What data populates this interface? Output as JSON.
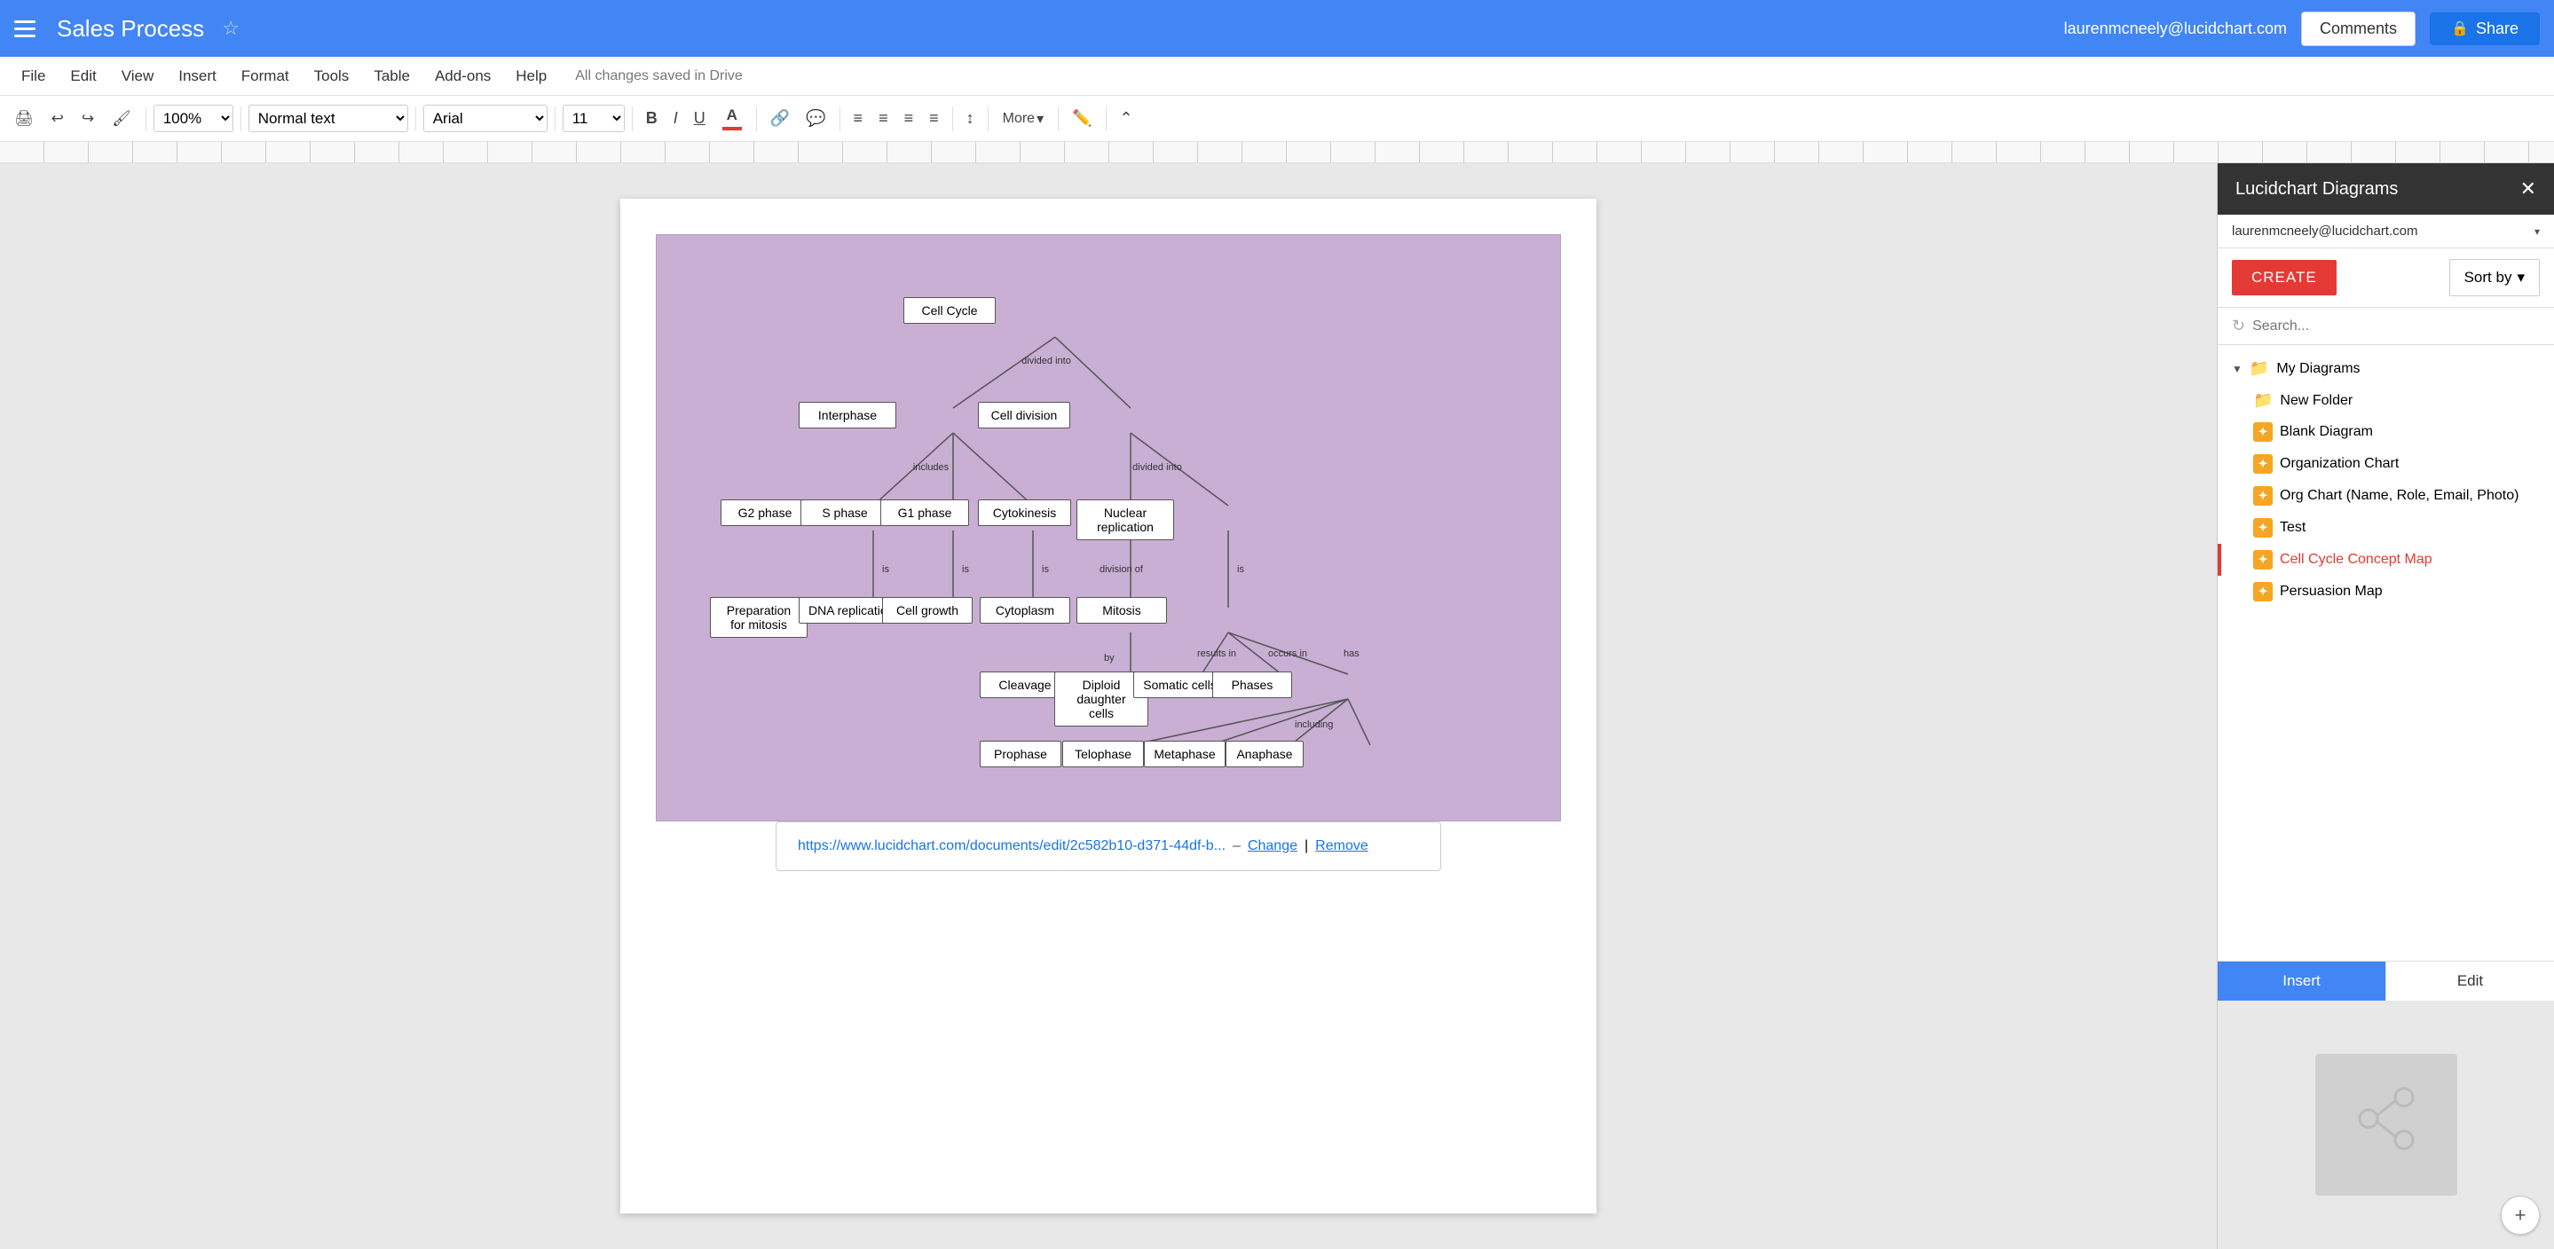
{
  "topbar": {
    "doc_title": "Sales Process",
    "user_email": "laurenmcneely@lucidchart.com",
    "comments_label": "Comments",
    "share_label": "Share",
    "lock_icon": "🔒"
  },
  "menubar": {
    "items": [
      "File",
      "Edit",
      "View",
      "Insert",
      "Format",
      "Tools",
      "Table",
      "Add-ons",
      "Help"
    ],
    "save_status": "All changes saved in Drive"
  },
  "toolbar": {
    "zoom": "100%",
    "style": "Normal text",
    "font": "Arial",
    "size": "11",
    "bold": "B",
    "italic": "I",
    "underline": "U",
    "more_label": "More"
  },
  "diagram": {
    "nodes": {
      "cell_cycle": "Cell Cycle",
      "interphase": "Interphase",
      "cell_division": "Cell division",
      "g2_phase": "G2 phase",
      "s_phase": "S phase",
      "g1_phase": "G1 phase",
      "cytokinesis": "Cytokinesis",
      "nuclear_replication": "Nuclear replication",
      "prep_mitosis": "Preparation for mitosis",
      "dna_replication": "DNA replication",
      "cell_growth": "Cell growth",
      "cytoplasm": "Cytoplasm",
      "mitosis": "Mitosis",
      "cleavage": "Cleavage",
      "diploid_daughter": "Diploid daughter cells",
      "somatic_cells": "Somatic cells",
      "phases": "Phases",
      "prophase": "Prophase",
      "telophase": "Telophase",
      "metaphase": "Metaphase",
      "anaphase": "Anaphase"
    },
    "edge_labels": {
      "divided_into": "divided into",
      "includes": "includes",
      "divided_into2": "divided into",
      "is": "is",
      "division_of": "division of",
      "by": "by",
      "results_in": "results in",
      "occurs_in": "occurs in",
      "has": "has",
      "including": "including"
    },
    "link_url": "https://www.lucidchart.com/documents/edit/2c582b10-d371-44df-b...",
    "link_change": "Change",
    "link_remove": "Remove",
    "link_separator": "–"
  },
  "sidebar": {
    "title": "Lucidchart Diagrams",
    "user_email": "laurenmcneely@lucidchart.com",
    "create_label": "CREATE",
    "sortby_label": "Sort by",
    "search_placeholder": "Search...",
    "folder_name": "My Diagrams",
    "items": [
      {
        "label": "New Folder",
        "type": "folder",
        "icon": "folder"
      },
      {
        "label": "Blank Diagram",
        "type": "diagram",
        "active": false
      },
      {
        "label": "Organization Chart",
        "type": "diagram",
        "active": false
      },
      {
        "label": "Org Chart (Name, Role, Email, Photo)",
        "type": "diagram",
        "active": false
      },
      {
        "label": "Test",
        "type": "diagram",
        "active": false
      },
      {
        "label": "Cell Cycle Concept Map",
        "type": "diagram",
        "active": true
      },
      {
        "label": "Persuasion Map",
        "type": "diagram",
        "active": false
      }
    ],
    "insert_label": "Insert",
    "edit_label": "Edit"
  }
}
